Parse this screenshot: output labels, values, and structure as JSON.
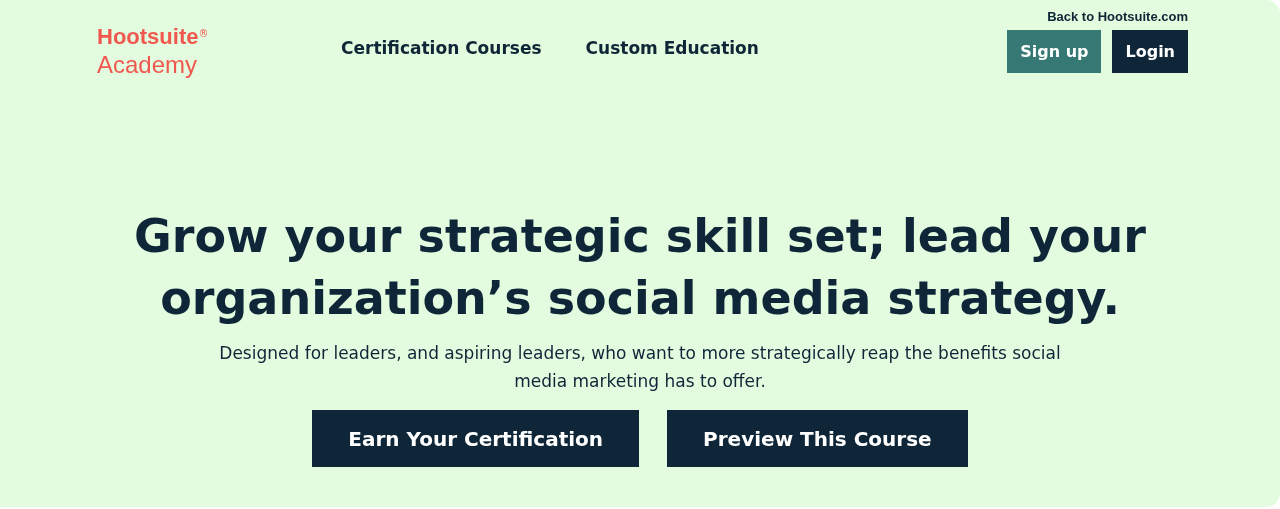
{
  "logo": {
    "name": "Hootsuite",
    "mark": "®",
    "sub": "Academy"
  },
  "nav": [
    {
      "label": "Certification Courses"
    },
    {
      "label": "Custom Education"
    }
  ],
  "back_link": "Back to Hootsuite.com",
  "header_buttons": [
    {
      "label": "Sign up",
      "kind": "secondary"
    },
    {
      "label": "Login",
      "kind": "primary"
    }
  ],
  "hero": {
    "headline": "Grow your strategic skill set; lead your organization’s social media strategy.",
    "subtext": "Designed for leaders, and aspiring leaders, who want to more strategically reap the benefits social media marketing has to offer.",
    "buttons": [
      {
        "label": "Earn Your Certification"
      },
      {
        "label": "Preview This Course"
      }
    ]
  }
}
